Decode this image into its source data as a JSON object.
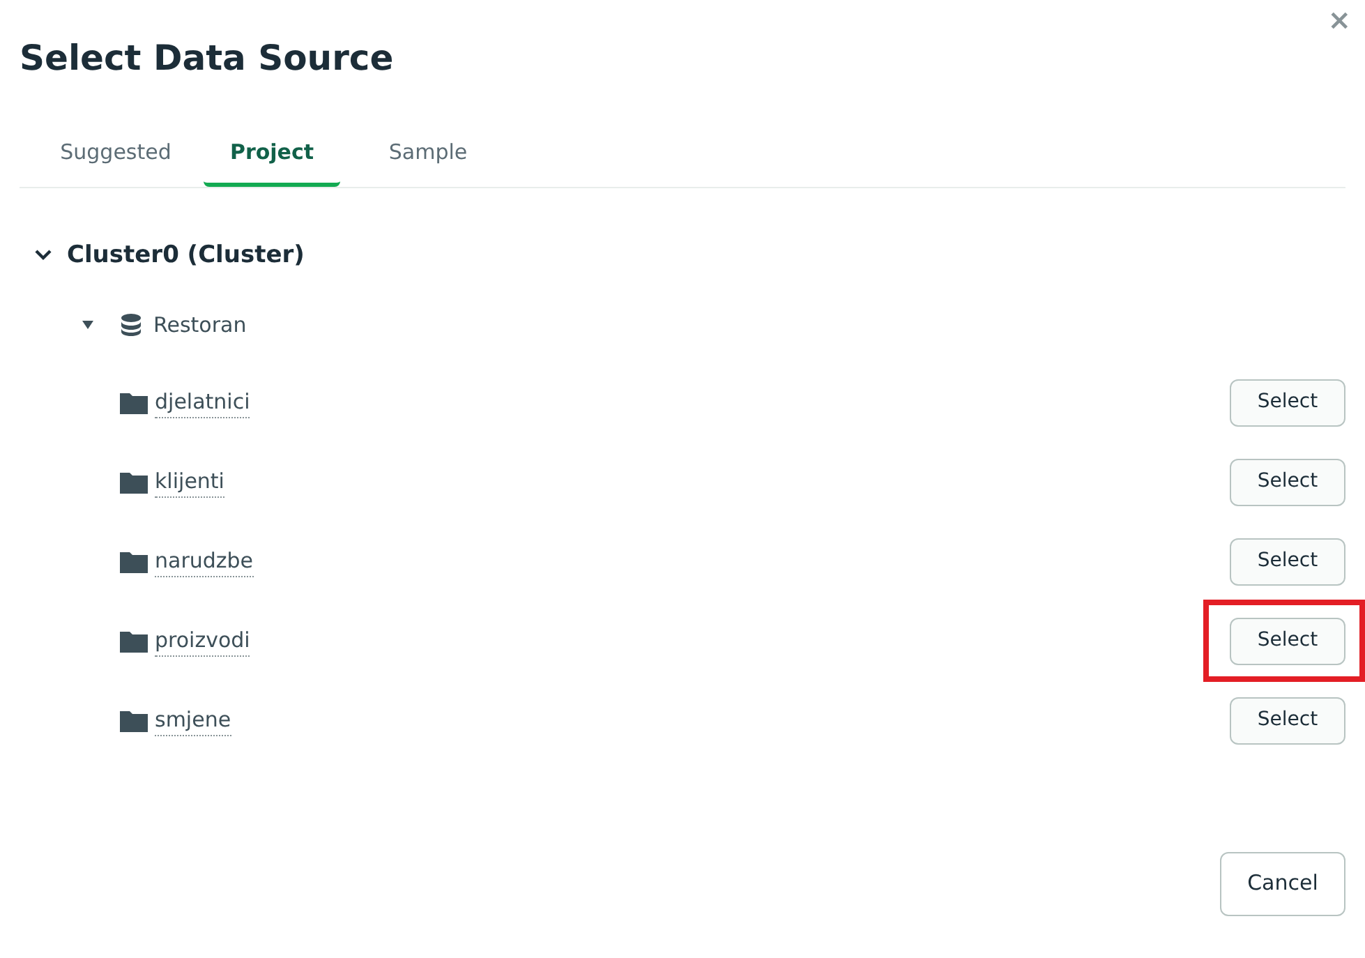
{
  "dialog": {
    "title": "Select Data Source",
    "close": "×"
  },
  "tabs": [
    {
      "label": "Suggested",
      "selected": false
    },
    {
      "label": "Project",
      "selected": true
    },
    {
      "label": "Sample",
      "selected": false
    }
  ],
  "cluster": {
    "name": "Cluster0 (Cluster)",
    "expanded": true,
    "database": {
      "name": "Restoran",
      "expanded": true,
      "collections": [
        {
          "name": "djelatnici",
          "action": "Select",
          "highlighted": false
        },
        {
          "name": "klijenti",
          "action": "Select",
          "highlighted": false
        },
        {
          "name": "narudzbe",
          "action": "Select",
          "highlighted": false
        },
        {
          "name": "proizvodi",
          "action": "Select",
          "highlighted": true
        },
        {
          "name": "smjene",
          "action": "Select",
          "highlighted": false
        }
      ]
    }
  },
  "buttons": {
    "cancel": "Cancel"
  }
}
